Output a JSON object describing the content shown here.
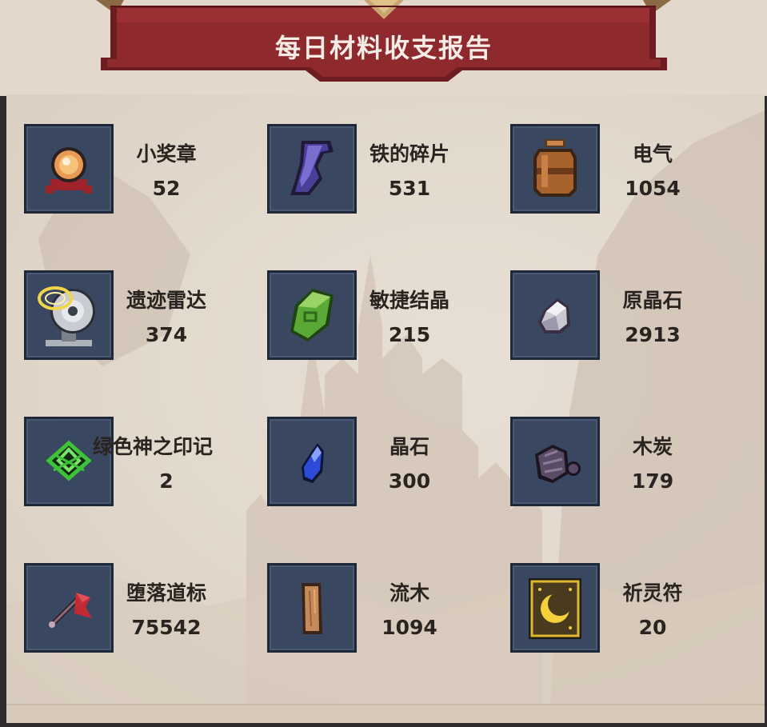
{
  "header": {
    "title": "每日材料收支报告"
  },
  "items": [
    {
      "name": "小奖章",
      "count": "52",
      "icon": "medal-icon"
    },
    {
      "name": "铁的碎片",
      "count": "531",
      "icon": "iron-shard-icon"
    },
    {
      "name": "电气",
      "count": "1054",
      "icon": "battery-jar-icon"
    },
    {
      "name": "遗迹雷达",
      "count": "374",
      "icon": "radar-dish-icon"
    },
    {
      "name": "敏捷结晶",
      "count": "215",
      "icon": "green-crystal-icon"
    },
    {
      "name": "原晶石",
      "count": "2913",
      "icon": "raw-crystal-icon"
    },
    {
      "name": "绿色神之印记",
      "count": "2",
      "icon": "green-seal-icon"
    },
    {
      "name": "晶石",
      "count": "300",
      "icon": "blue-crystal-icon"
    },
    {
      "name": "木炭",
      "count": "179",
      "icon": "charcoal-icon"
    },
    {
      "name": "堕落道标",
      "count": "75542",
      "icon": "fallen-flag-icon"
    },
    {
      "name": "流木",
      "count": "1094",
      "icon": "driftwood-icon"
    },
    {
      "name": "祈灵符",
      "count": "20",
      "icon": "prayer-card-icon"
    }
  ],
  "colors": {
    "banner": "#8e2a2e",
    "slot": "#3a4760",
    "panel": "#e3dace",
    "text": "#2a2420"
  }
}
